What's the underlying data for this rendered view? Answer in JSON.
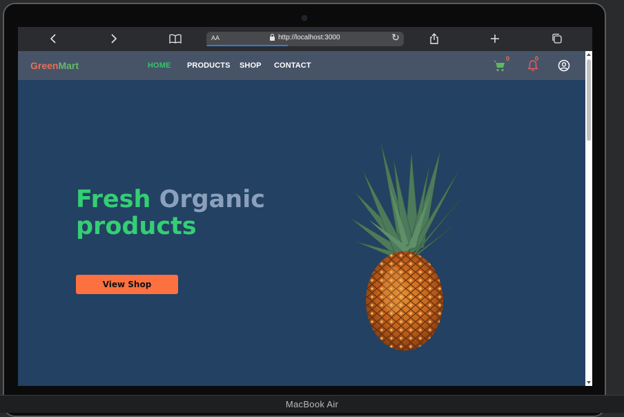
{
  "device": {
    "label": "MacBook Air"
  },
  "browser": {
    "text_size_label": "AA",
    "url": "http://localhost:3000",
    "icons": [
      "back-icon",
      "forward-icon",
      "bookmarks-icon",
      "lock-icon",
      "reload-icon",
      "share-icon",
      "new-tab-icon",
      "tabs-icon"
    ]
  },
  "navbar": {
    "brand_part1": "Green",
    "brand_part2": "Mart",
    "links": [
      {
        "label": "HOME",
        "active": true
      },
      {
        "label": "PRODUCTS",
        "active": false
      },
      {
        "label": "SHOP",
        "active": false
      },
      {
        "label": "CONTACT",
        "active": false
      }
    ],
    "cart_count": "0",
    "notification_count": "0"
  },
  "hero": {
    "title_word1": "Fresh",
    "title_word2": "Organic",
    "title_line2": "products",
    "cta_label": "View Shop"
  },
  "colors": {
    "navbar_bg": "#475468",
    "page_bg": "#234162",
    "accent_green": "#33cf74",
    "brand_orange": "#ee6d54",
    "cta_orange": "#fd7040"
  }
}
